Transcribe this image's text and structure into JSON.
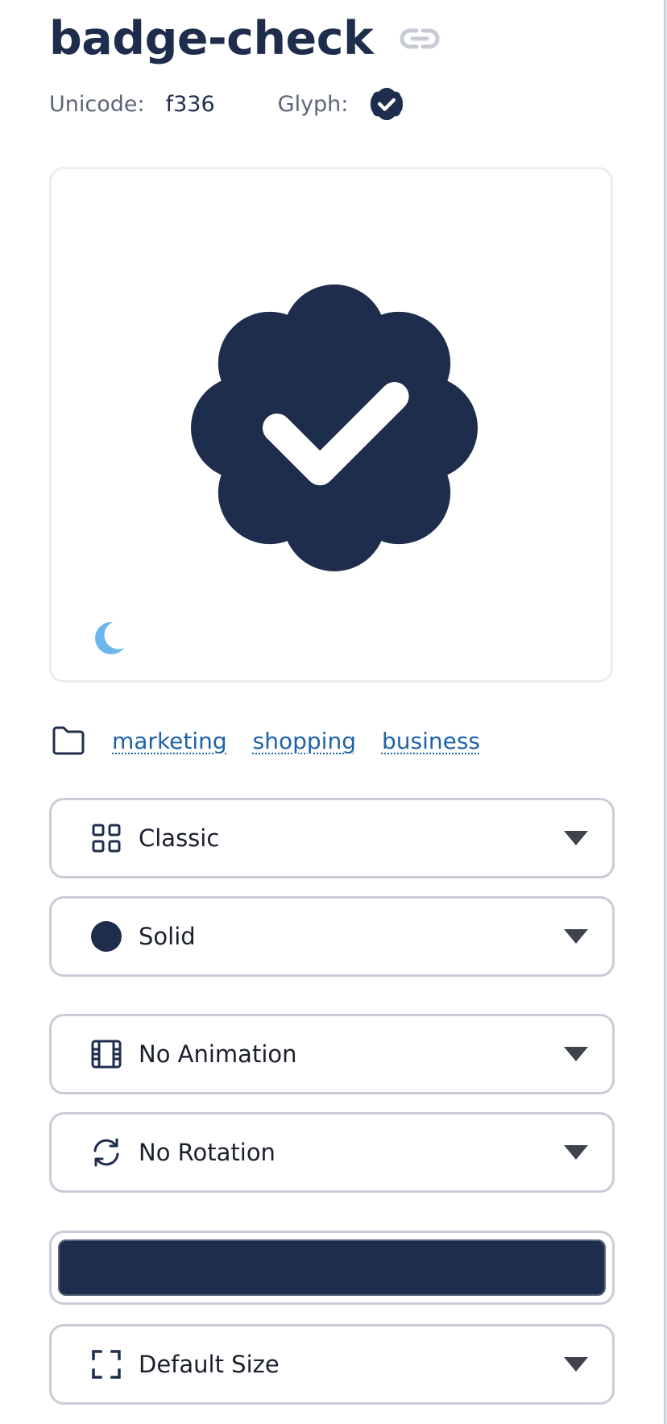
{
  "icon": {
    "name": "badge-check",
    "unicode_label": "Unicode:",
    "unicode_value": "f336",
    "glyph_label": "Glyph:"
  },
  "colors": {
    "primary": "#1f2d4d",
    "link": "#1e63a8",
    "moon": "#6cb6ee",
    "muted": "#5c6478",
    "border": "#c9ccd6",
    "link_icon": "#c7cbd4"
  },
  "categories": [
    {
      "label": "marketing"
    },
    {
      "label": "shopping"
    },
    {
      "label": "business"
    }
  ],
  "controls": {
    "family": {
      "label": "Classic",
      "icon": "grid-icon"
    },
    "style": {
      "label": "Solid",
      "icon": "solid-circle-icon"
    },
    "animation": {
      "label": "No Animation",
      "icon": "film-icon"
    },
    "rotation": {
      "label": "No Rotation",
      "icon": "rotate-arrows-icon"
    },
    "color": {
      "value": "#1f2d4d"
    },
    "size": {
      "label": "Default Size",
      "icon": "expand-corners-icon"
    }
  }
}
